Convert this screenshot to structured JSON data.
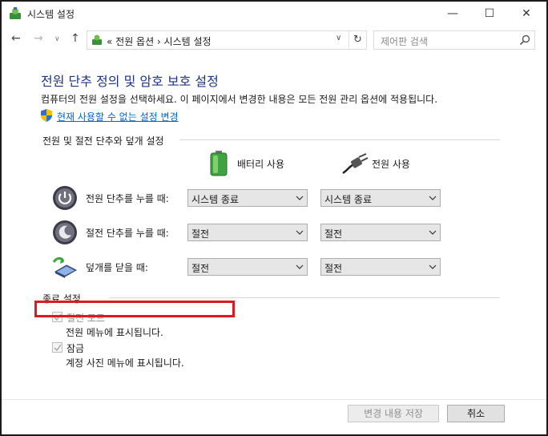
{
  "window": {
    "title": "시스템 설정",
    "controls": {
      "minimize": "—",
      "maximize": "☐",
      "close": "✕"
    }
  },
  "nav": {
    "back": "←",
    "forward": "→",
    "dropdown": "∨",
    "up": "↑"
  },
  "address": {
    "path": "« 전원 옵션 › 시스템 설정",
    "dropdown": "∨",
    "refresh": "↻"
  },
  "search": {
    "placeholder": "제어판 검색"
  },
  "page": {
    "title": "전원 단추 정의 및 암호 보호 설정",
    "description": "컴퓨터의 전원 설정을 선택하세요. 이 페이지에서 변경한 내용은 모든 전원 관리 옵션에 적용됩니다.",
    "change_link": "현재 사용할 수 없는 설정 변경"
  },
  "buttons_section": {
    "header": "전원 및 절전 단추와 덮개 설정",
    "columns": {
      "battery": "배터리 사용",
      "plugged": "전원 사용"
    },
    "rows": [
      {
        "label": "전원 단추를 누를 때:",
        "battery": "시스템 종료",
        "plugged": "시스템 종료",
        "icon": "power-button-icon"
      },
      {
        "label": "절전 단추를 누를 때:",
        "battery": "절전",
        "plugged": "절전",
        "icon": "sleep-button-icon"
      },
      {
        "label": "덮개를 닫을 때:",
        "battery": "절전",
        "plugged": "절전",
        "icon": "laptop-lid-icon"
      }
    ]
  },
  "shutdown_section": {
    "header": "종료 설정",
    "items": [
      {
        "label": "절전 모드",
        "description": "전원 메뉴에 표시됩니다.",
        "checked": true,
        "enabled": false
      },
      {
        "label": "잠금",
        "description": "계정 사진 메뉴에 표시됩니다.",
        "checked": true,
        "enabled": false
      }
    ]
  },
  "footer": {
    "save": "변경 내용 저장",
    "cancel": "취소"
  },
  "colors": {
    "title": "#1e3287",
    "link": "#0066cc",
    "highlight": "#e0191f"
  }
}
